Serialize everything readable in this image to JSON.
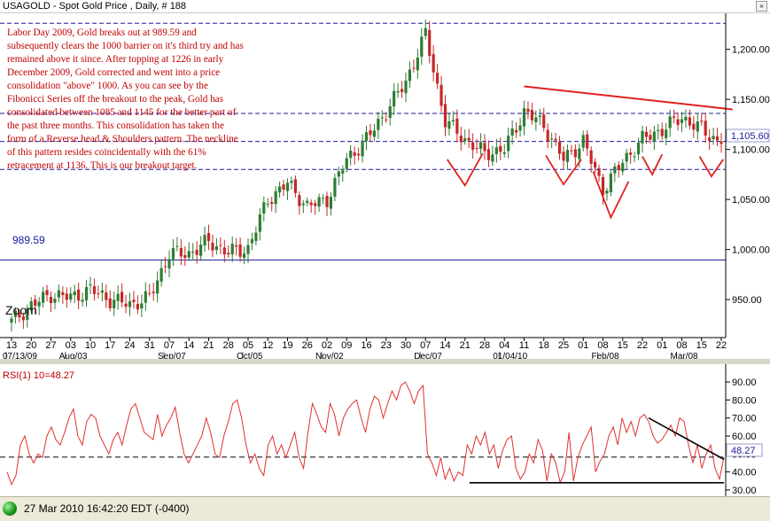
{
  "header": {
    "title": "USAGOLD - Spot Gold Price , Daily, # 188",
    "close_symbol": "×"
  },
  "annotation": "Labor Day 2009, Gold breaks out at 989.59 and subsequently clears the 1000 barrier on it's third try and has remained above it since.  After topping at 1226 in early December 2009, Gold corrected and went into a price consolidation \"above\" 1000.  As you can see by the Fibonicci Series off the breakout to the peak, Gold has consolidated between 1085 and 1145 for the better part of the past three months.  This consolidation has taken the form of a Reverse head & Shoulders pattern.  The neckline of this pattern resides coincidentally with the 61% retracement at 1136.  This is our breakout target.",
  "zoom_label": "Zoom",
  "status": {
    "text": "27 Mar 2010 16:42:20  EDT (-0400)"
  },
  "chart_data": [
    {
      "type": "candlestick",
      "ylim": [
        912,
        1236
      ],
      "y_ticks": [
        "1,200.00",
        "1,150.00",
        "1,100.00",
        "1,050.00",
        "1,000.00",
        "950.00"
      ],
      "y_tick_values": [
        1200,
        1150,
        1100,
        1050,
        1000,
        950
      ],
      "current_price_label": "1,105.60",
      "current_price": 1105.6,
      "breakout_label": "989.59",
      "breakout_level": 989.59,
      "fibonacci_levels": [
        1226,
        1136,
        1108,
        1080
      ],
      "neckline": {
        "from": [
          "2010-01-11",
          1163
        ],
        "to": [
          "2010-03-26",
          1140
        ]
      },
      "x_day_labels": [
        "13",
        "20",
        "27",
        "03",
        "10",
        "17",
        "24",
        "31",
        "07",
        "14",
        "21",
        "28",
        "05",
        "12",
        "19",
        "26",
        "02",
        "09",
        "16",
        "23",
        "30",
        "07",
        "14",
        "21",
        "28",
        "04",
        "11",
        "18",
        "25",
        "01",
        "08",
        "15",
        "22",
        "01",
        "08",
        "15",
        "22"
      ],
      "x_period_labels": [
        {
          "label": "07/13/09",
          "index": 0
        },
        {
          "label": "Aug/03",
          "index": 3
        },
        {
          "label": "Sep/07",
          "index": 8
        },
        {
          "label": "Oct/05",
          "index": 12
        },
        {
          "label": "Nov/02",
          "index": 16
        },
        {
          "label": "Dec/07",
          "index": 21
        },
        {
          "label": "01/04/10",
          "index": 25
        },
        {
          "label": "Feb/08",
          "index": 30
        },
        {
          "label": "Mar/08",
          "index": 34
        }
      ],
      "weekly_closes": [
        928,
        944,
        955,
        952,
        960,
        950,
        945,
        952,
        996,
        996,
        1008,
        997,
        1001,
        1050,
        1066,
        1043,
        1050,
        1090,
        1110,
        1138,
        1168,
        1215,
        1128,
        1110,
        1096,
        1100,
        1138,
        1124,
        1090,
        1108,
        1060,
        1088,
        1110,
        1120,
        1132,
        1120,
        1105.6
      ]
    },
    {
      "type": "line",
      "title": "RSI(1) 10=48.27",
      "ylim": [
        28,
        94
      ],
      "y_ticks": [
        "90.00",
        "80.00",
        "70.00",
        "60.00",
        "50.00",
        "40.00",
        "30.00"
      ],
      "y_tick_values": [
        90,
        80,
        70,
        60,
        50,
        40,
        30
      ],
      "current_label": "48.27",
      "current_value": 48.27,
      "reference_level": 48.27,
      "support_line": {
        "from": [
          0.645,
          34
        ],
        "to": [
          1.0,
          34
        ]
      },
      "resistance_line": {
        "from": [
          0.895,
          70
        ],
        "to": [
          1.0,
          47
        ]
      },
      "series": [
        {
          "values": [
            40,
            33,
            38,
            55,
            60,
            50,
            45,
            50,
            48,
            60,
            65,
            58,
            55,
            62,
            70,
            75,
            60,
            55,
            68,
            72,
            70,
            60,
            55,
            50,
            58,
            62,
            55,
            66,
            75,
            78,
            70,
            62,
            60,
            58,
            72,
            60,
            66,
            70,
            76,
            62,
            50,
            45,
            50,
            55,
            60,
            70,
            62,
            50,
            48,
            60,
            68,
            78,
            80,
            70,
            55,
            45,
            50,
            42,
            38,
            55,
            60,
            50,
            55,
            48,
            55,
            62,
            48,
            42,
            62,
            78,
            72,
            65,
            62,
            78,
            72,
            60,
            70,
            75,
            78,
            80,
            70,
            62,
            75,
            82,
            80,
            70,
            78,
            85,
            80,
            88,
            90,
            85,
            78,
            85,
            88,
            50,
            45,
            38,
            48,
            36,
            42,
            35,
            40,
            38,
            55,
            50,
            60,
            55,
            62,
            50,
            55,
            42,
            52,
            58,
            60,
            42,
            36,
            40,
            50,
            45,
            58,
            52,
            35,
            50,
            45,
            34,
            40,
            62,
            35,
            48,
            55,
            60,
            65,
            40,
            46,
            50,
            60,
            65,
            55,
            70,
            62,
            68,
            60,
            70,
            72,
            68,
            60,
            56,
            58,
            62,
            66,
            60,
            70,
            68,
            55,
            45,
            55,
            42,
            50,
            55,
            42,
            36,
            48.27
          ]
        }
      ]
    }
  ],
  "colors": {
    "background": "#ffffff",
    "frame": "#ece9d8",
    "bull_candle": "#2e7d32",
    "bear_candle": "#c62828",
    "annotation_text": "#c00000",
    "fib_lines": "#1a1a9c",
    "neckline": "#e02020",
    "head_shoulders_marks": "#e02020",
    "rsi_line": "#e03030",
    "rsi_trend_lines": "#000000"
  }
}
